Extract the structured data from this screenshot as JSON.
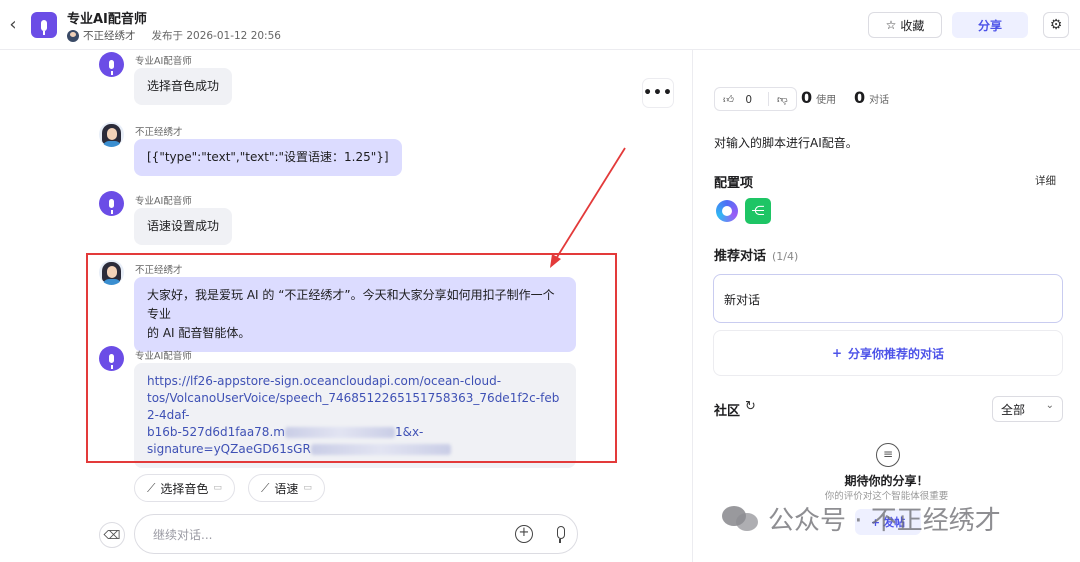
{
  "header": {
    "title": "专业AI配音师",
    "author": "不正经绣才",
    "published": "发布于 2026-01-12 20:56",
    "collect_label": "收藏",
    "share_label": "分享"
  },
  "chat": {
    "messages": [
      {
        "sender": "专业AI配音师",
        "role": "bot",
        "text": "选择音色成功"
      },
      {
        "sender": "不正经绣才",
        "role": "user",
        "text": "[{\"type\":\"text\",\"text\":\"设置语速：1.25\"}]"
      },
      {
        "sender": "专业AI配音师",
        "role": "bot",
        "text": "语速设置成功"
      },
      {
        "sender": "不正经绣才",
        "role": "user",
        "text_line1": "大家好，我是爱玩 AI 的 “不正经绣才”。今天和大家分享如何用扣子制作一个专业",
        "text_line2": "的 AI 配音智能体。"
      },
      {
        "sender": "专业AI配音师",
        "role": "bot",
        "link_line1": "https://lf26-appstore-sign.oceancloudapi.com/ocean-cloud-",
        "link_line2": "tos/VolcanoUserVoice/speech_7468512265151758363_76de1f2c-feb2-4daf-",
        "link_line3": "b16b-527d6d1faa78.m",
        "link_line3_end": "1&x-",
        "link_line4": "signature=yQZaeGD61sGR"
      }
    ],
    "more_label": "•••",
    "chips": [
      {
        "label": "选择音色",
        "icon": "magic-wand-icon"
      },
      {
        "label": "语速",
        "icon": "magic-wand-icon"
      }
    ],
    "input_placeholder": "继续对话..."
  },
  "panel": {
    "like_count": "0",
    "uses_count": "0",
    "uses_label": "使用",
    "dialogs_count": "0",
    "dialogs_label": "对话",
    "description": "对输入的脚本进行AI配音。",
    "config_title": "配置项",
    "config_detail": "详细",
    "recommend_title": "推荐对话",
    "recommend_count": "(1/4)",
    "new_chat": "新对话",
    "share_recommend": "分享你推荐的对话",
    "community_title": "社区",
    "filter_value": "全部",
    "empty_title": "期待你的分享！",
    "empty_sub": "你的评价对这个智能体很重要",
    "post_label": "发帖"
  },
  "watermark": {
    "text": "公众号 · 不正经绣才"
  },
  "colors": {
    "accent": "#4d53e8",
    "user_bubble": "#dcdcff",
    "bot_bubble": "#f0f1f5",
    "highlight_box": "#e33a3a",
    "annotation_arrow": "#e33a3a"
  }
}
